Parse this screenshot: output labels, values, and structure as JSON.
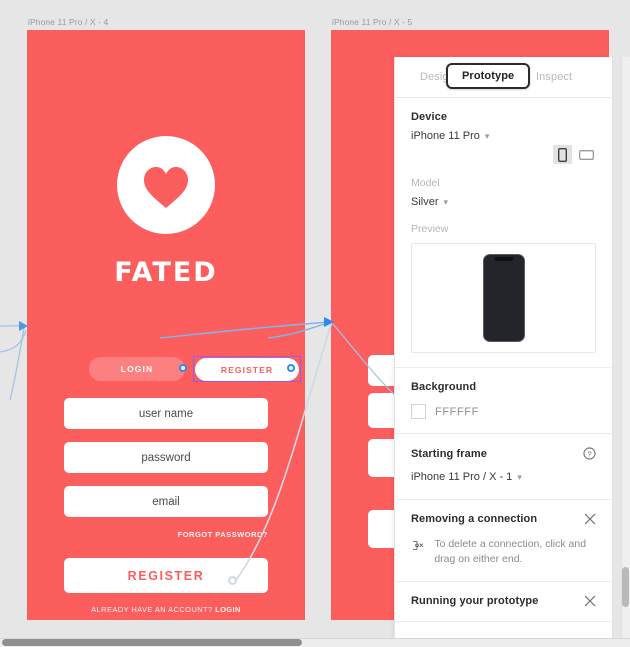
{
  "canvas": {
    "background_color": "#e6e6e6",
    "artboards": [
      {
        "label": "iPhone 11 Pro / X - 4",
        "background_color": "#fc5d5d",
        "brand": "FATED",
        "logo_icon": "heart-in-circle-logo",
        "tabs": {
          "login": "LOGIN",
          "register": "REGISTER"
        },
        "fields": [
          {
            "placeholder": "user name"
          },
          {
            "placeholder": "password"
          },
          {
            "placeholder": "email"
          }
        ],
        "forgot_password": "FORGOT PASSWORD?",
        "submit_button": "REGISTER",
        "footer_text": "ALREADY HAVE AN ACCOUNT? ",
        "footer_link": "LOGIN"
      },
      {
        "label": "iPhone 11 Pro / X - 5",
        "background_color": "#fc5d5d"
      }
    ]
  },
  "panel": {
    "tabs": [
      {
        "label": "Design",
        "active": false
      },
      {
        "label": "Prototype",
        "active": true
      },
      {
        "label": "Inspect",
        "active": false
      }
    ],
    "device": {
      "section_title": "Device",
      "device_value": "iPhone 11 Pro",
      "model_label": "Model",
      "model_value": "Silver",
      "preview_label": "Preview",
      "orientation_portrait_icon": "portrait-orientation-icon",
      "orientation_landscape_icon": "landscape-orientation-icon",
      "preview_device_icon": "iphone-preview-thumbnail"
    },
    "background": {
      "section_title": "Background",
      "color_hex": "FFFFFF"
    },
    "starting_frame": {
      "section_title": "Starting frame",
      "value": "iPhone 11 Pro / X - 1",
      "help_icon": "help-question-icon"
    },
    "tips": [
      {
        "title": "Removing a connection",
        "body": "To delete a connection, click and drag on either end.",
        "icon": "delete-connection-icon",
        "close_icon": "close-icon"
      },
      {
        "title": "Running your prototype",
        "body": "",
        "icon": "",
        "close_icon": "close-icon"
      }
    ]
  },
  "colors": {
    "accent_red": "#fc5d5d",
    "selection_purple": "#8b5cf6",
    "connection_blue": "#2b8bf2",
    "panel_bg": "#ffffff"
  }
}
